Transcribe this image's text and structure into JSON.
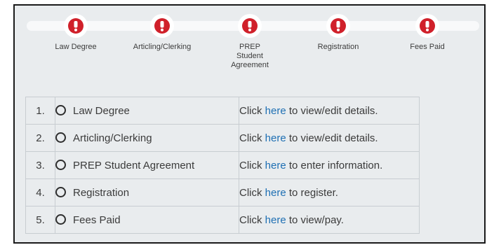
{
  "steps": [
    {
      "label": "Law Degree"
    },
    {
      "label": "Articling/Clerking"
    },
    {
      "label": "PREP Student Agreement"
    },
    {
      "label": "Registration"
    },
    {
      "label": "Fees Paid"
    }
  ],
  "rows": [
    {
      "num": "1.",
      "item": "Law Degree",
      "pre": "Click ",
      "link": "here",
      "post": " to view/edit details."
    },
    {
      "num": "2.",
      "item": "Articling/Clerking",
      "pre": "Click ",
      "link": "here",
      "post": " to view/edit details."
    },
    {
      "num": "3.",
      "item": "PREP Student Agreement",
      "pre": "Click ",
      "link": "here",
      "post": " to enter information."
    },
    {
      "num": "4.",
      "item": "Registration",
      "pre": "Click ",
      "link": "here",
      "post": " to register."
    },
    {
      "num": "5.",
      "item": "Fees Paid",
      "pre": "Click ",
      "link": "here",
      "post": " to view/pay."
    }
  ],
  "colors": {
    "alert": "#d0202a",
    "link": "#1e6fb3",
    "panel": "#e9ecee"
  },
  "icons": {
    "step_status": "exclamation-icon",
    "item_status": "radio-empty-icon"
  }
}
